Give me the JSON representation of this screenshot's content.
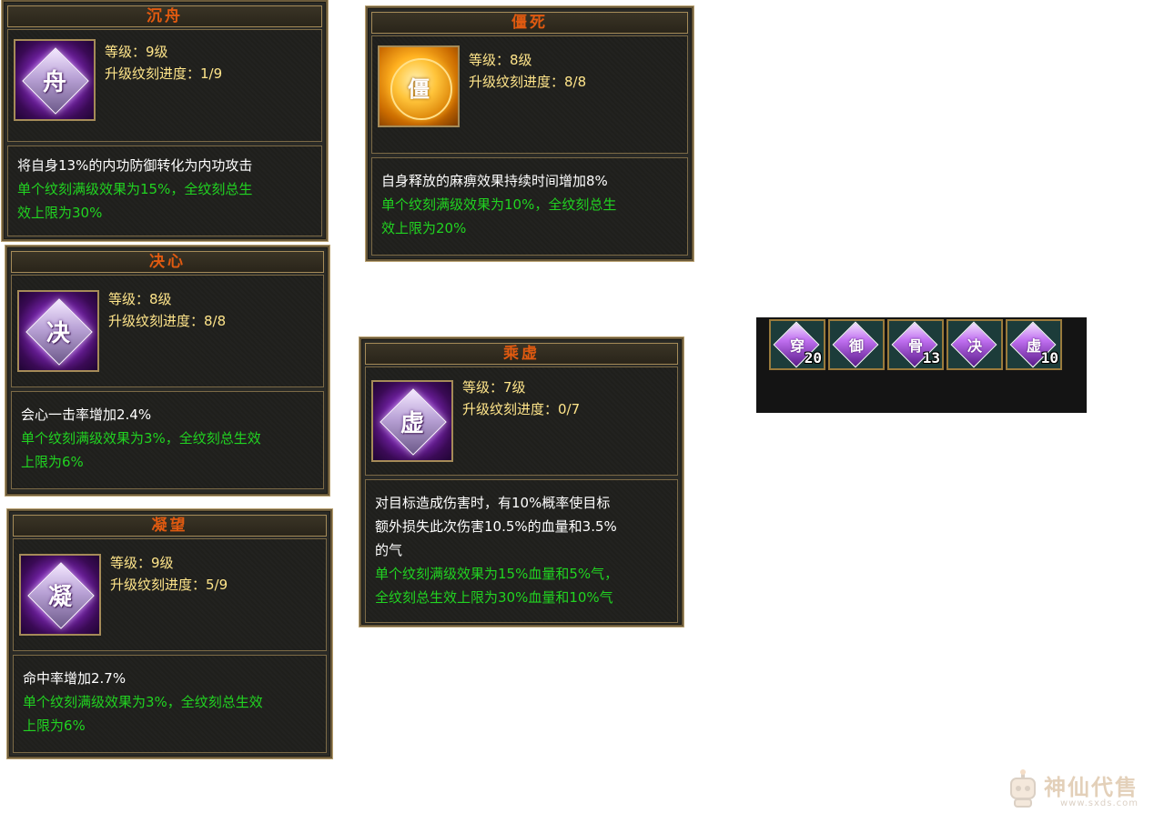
{
  "cards": [
    {
      "title": "沉舟",
      "glyph": "舟",
      "level": "等级：9级",
      "progress": "升级纹刻进度：1/9",
      "desc_white": "将自身13%的内功防御转化为内功攻击",
      "desc_green_1": "单个纹刻满级效果为15%，全纹刻总生",
      "desc_green_2": "效上限为30%"
    },
    {
      "title": "僵死",
      "glyph": "僵",
      "level": "等级：8级",
      "progress": "升级纹刻进度：8/8",
      "desc_white": "自身释放的麻痹效果持续时间增加8%",
      "desc_green_1": "单个纹刻满级效果为10%，全纹刻总生",
      "desc_green_2": "效上限为20%"
    },
    {
      "title": "决心",
      "glyph": "决",
      "level": "等级：8级",
      "progress": "升级纹刻进度：8/8",
      "desc_white": "会心一击率增加2.4%",
      "desc_green_1": "单个纹刻满级效果为3%，全纹刻总生效",
      "desc_green_2": "上限为6%"
    },
    {
      "title": "乘虚",
      "glyph": "虚",
      "level": "等级：7级",
      "progress": "升级纹刻进度：0/7",
      "desc_white_1": "对目标造成伤害时，有10%概率使目标",
      "desc_white_2": "额外损失此次伤害10.5%的血量和3.5%",
      "desc_white_3": "的气",
      "desc_green_1": "单个纹刻满级效果为15%血量和5%气，",
      "desc_green_2": "全纹刻总生效上限为30%血量和10%气"
    },
    {
      "title": "凝望",
      "glyph": "凝",
      "level": "等级：9级",
      "progress": "升级纹刻进度：5/9",
      "desc_white": "命中率增加2.7%",
      "desc_green_1": "单个纹刻满级效果为3%，全纹刻总生效",
      "desc_green_2": "上限为6%"
    }
  ],
  "inventory": [
    {
      "glyph": "穿",
      "count": "20",
      "icon": "rune-item-icon"
    },
    {
      "glyph": "御",
      "count": "",
      "icon": "rune-item-icon"
    },
    {
      "glyph": "骨",
      "count": "13",
      "icon": "rune-item-icon"
    },
    {
      "glyph": "决",
      "count": "",
      "icon": "rune-item-icon"
    },
    {
      "glyph": "虚",
      "count": "10",
      "icon": "rune-item-icon"
    }
  ],
  "watermark": {
    "text": "神仙代售",
    "url": "www.sxds.com"
  },
  "colors": {
    "title": "#e05a10",
    "stat": "#ffe58a",
    "desc": "#ffffff",
    "effect": "#21d321",
    "frame": "#a58b58",
    "background": "#ffffff"
  }
}
